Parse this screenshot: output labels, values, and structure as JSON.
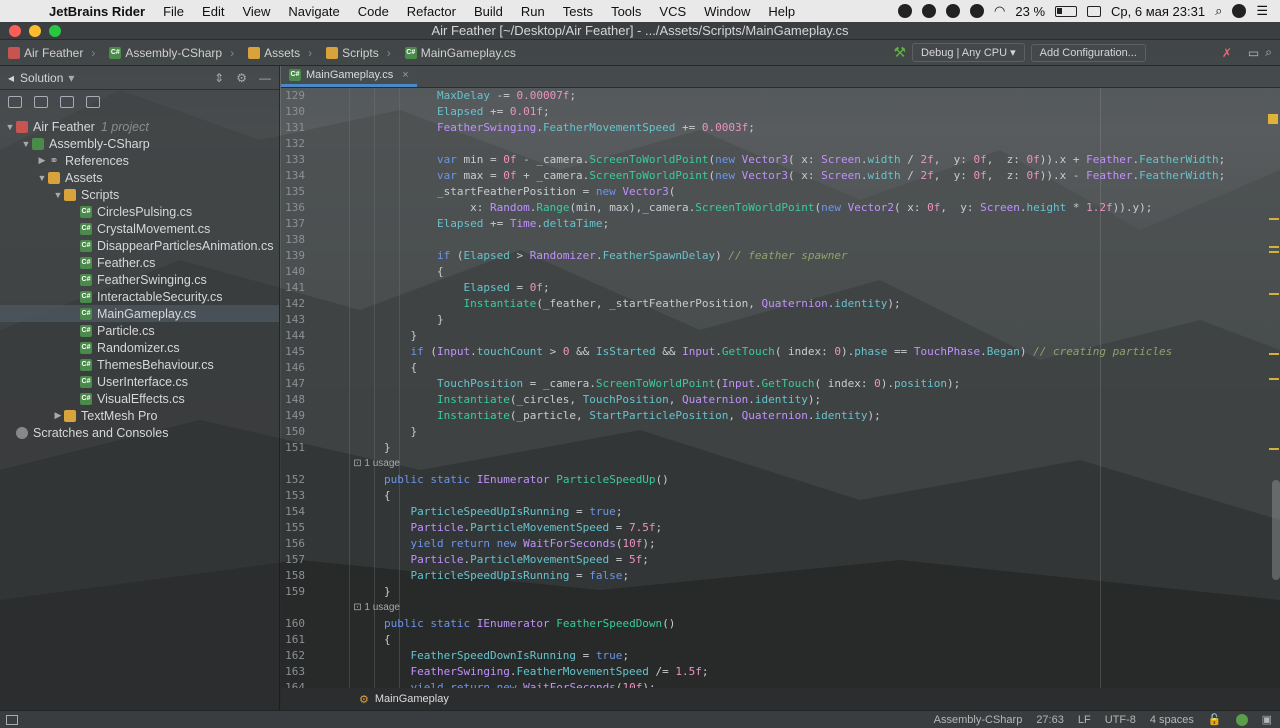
{
  "menubar": {
    "app_name": "JetBrains Rider",
    "items": [
      "File",
      "Edit",
      "View",
      "Navigate",
      "Code",
      "Refactor",
      "Build",
      "Run",
      "Tests",
      "Tools",
      "VCS",
      "Window",
      "Help"
    ],
    "battery": "23 %",
    "datetime": "Ср, 6 мая  23:31"
  },
  "window": {
    "title": "Air Feather [~/Desktop/Air Feather] - .../Assets/Scripts/MainGameplay.cs"
  },
  "navbar": {
    "crumbs": [
      "Air Feather",
      "Assembly-CSharp",
      "Assets",
      "Scripts",
      "MainGameplay.cs"
    ],
    "run_config": "Debug | Any CPU",
    "add_config": "Add Configuration..."
  },
  "sidebar": {
    "header": "Solution",
    "tree": [
      {
        "label": "Air Feather",
        "extra": "1 project",
        "indent": 0,
        "kind": "proj",
        "arrow": "▼"
      },
      {
        "label": "Assembly-CSharp",
        "indent": 1,
        "kind": "asm",
        "arrow": "▼"
      },
      {
        "label": "References",
        "indent": 2,
        "kind": "refs",
        "arrow": "▶"
      },
      {
        "label": "Assets",
        "indent": 2,
        "kind": "folder",
        "arrow": "▼"
      },
      {
        "label": "Scripts",
        "indent": 3,
        "kind": "folder",
        "arrow": "▼"
      },
      {
        "label": "CirclesPulsing.cs",
        "indent": 4,
        "kind": "cs"
      },
      {
        "label": "CrystalMovement.cs",
        "indent": 4,
        "kind": "cs"
      },
      {
        "label": "DisappearParticlesAnimation.cs",
        "indent": 4,
        "kind": "cs"
      },
      {
        "label": "Feather.cs",
        "indent": 4,
        "kind": "cs"
      },
      {
        "label": "FeatherSwinging.cs",
        "indent": 4,
        "kind": "cs"
      },
      {
        "label": "InteractableSecurity.cs",
        "indent": 4,
        "kind": "cs"
      },
      {
        "label": "MainGameplay.cs",
        "indent": 4,
        "kind": "cs",
        "selected": true
      },
      {
        "label": "Particle.cs",
        "indent": 4,
        "kind": "cs"
      },
      {
        "label": "Randomizer.cs",
        "indent": 4,
        "kind": "cs"
      },
      {
        "label": "ThemesBehaviour.cs",
        "indent": 4,
        "kind": "cs"
      },
      {
        "label": "UserInterface.cs",
        "indent": 4,
        "kind": "cs"
      },
      {
        "label": "VisualEffects.cs",
        "indent": 4,
        "kind": "cs"
      },
      {
        "label": "TextMesh Pro",
        "indent": 3,
        "kind": "folder",
        "arrow": "▶"
      },
      {
        "label": "Scratches and Consoles",
        "indent": 0,
        "kind": "scratch"
      }
    ]
  },
  "editor": {
    "tab": "MainGameplay.cs",
    "lines": [
      {
        "n": "129",
        "t": "                MaxDelay -= 0.00007f;"
      },
      {
        "n": "130",
        "t": "                Elapsed += 0.01f;"
      },
      {
        "n": "131",
        "t": "                FeatherSwinging.FeatherMovementSpeed += 0.0003f;"
      },
      {
        "n": "132",
        "t": ""
      },
      {
        "n": "133",
        "t": "                var min = 0f - _camera.ScreenToWorldPoint(new Vector3( x: Screen.width / 2f,  y: 0f,  z: 0f)).x + Feather.FeatherWidth;"
      },
      {
        "n": "134",
        "t": "                var max = 0f + _camera.ScreenToWorldPoint(new Vector3( x: Screen.width / 2f,  y: 0f,  z: 0f)).x - Feather.FeatherWidth;"
      },
      {
        "n": "135",
        "t": "                _startFeatherPosition = new Vector3("
      },
      {
        "n": "136",
        "t": "                     x: Random.Range(min, max),_camera.ScreenToWorldPoint(new Vector2( x: 0f,  y: Screen.height * 1.2f)).y);"
      },
      {
        "n": "137",
        "t": "                Elapsed += Time.deltaTime;"
      },
      {
        "n": "138",
        "t": ""
      },
      {
        "n": "139",
        "t": "                if (Elapsed > Randomizer.FeatherSpawnDelay) // feather spawner"
      },
      {
        "n": "140",
        "t": "                {"
      },
      {
        "n": "141",
        "t": "                    Elapsed = 0f;"
      },
      {
        "n": "142",
        "t": "                    Instantiate(_feather, _startFeatherPosition, Quaternion.identity);"
      },
      {
        "n": "143",
        "t": "                }"
      },
      {
        "n": "144",
        "t": "            }"
      },
      {
        "n": "145",
        "t": "            if (Input.touchCount > 0 && IsStarted && Input.GetTouch( index: 0).phase == TouchPhase.Began) // creating particles"
      },
      {
        "n": "146",
        "t": "            {"
      },
      {
        "n": "147",
        "t": "                TouchPosition = _camera.ScreenToWorldPoint(Input.GetTouch( index: 0).position);"
      },
      {
        "n": "148",
        "t": "                Instantiate(_circles, TouchPosition, Quaternion.identity);"
      },
      {
        "n": "149",
        "t": "                Instantiate(_particle, StartParticlePosition, Quaternion.identity);"
      },
      {
        "n": "150",
        "t": "            }"
      },
      {
        "n": "151",
        "t": "        }"
      },
      {
        "n": "",
        "t": "        ⊡ 1 usage",
        "usage": true
      },
      {
        "n": "152",
        "t": "        public static IEnumerator ParticleSpeedUp()"
      },
      {
        "n": "153",
        "t": "        {"
      },
      {
        "n": "154",
        "t": "            ParticleSpeedUpIsRunning = true;"
      },
      {
        "n": "155",
        "t": "            Particle.ParticleMovementSpeed = 7.5f;"
      },
      {
        "n": "156",
        "t": "            yield return new WaitForSeconds(10f);"
      },
      {
        "n": "157",
        "t": "            Particle.ParticleMovementSpeed = 5f;"
      },
      {
        "n": "158",
        "t": "            ParticleSpeedUpIsRunning = false;"
      },
      {
        "n": "159",
        "t": "        }"
      },
      {
        "n": "",
        "t": "        ⊡ 1 usage",
        "usage": true
      },
      {
        "n": "160",
        "t": "        public static IEnumerator FeatherSpeedDown()"
      },
      {
        "n": "161",
        "t": "        {"
      },
      {
        "n": "162",
        "t": "            FeatherSpeedDownIsRunning = true;"
      },
      {
        "n": "163",
        "t": "            FeatherSwinging.FeatherMovementSpeed /= 1.5f;"
      },
      {
        "n": "164",
        "t": "            yield return new WaitForSeconds(10f);"
      }
    ],
    "breadcrumb": "MainGameplay"
  },
  "statusbar": {
    "context": "Assembly-CSharp",
    "position": "27:63",
    "line_sep": "LF",
    "encoding": "UTF-8",
    "indent": "4 spaces"
  }
}
